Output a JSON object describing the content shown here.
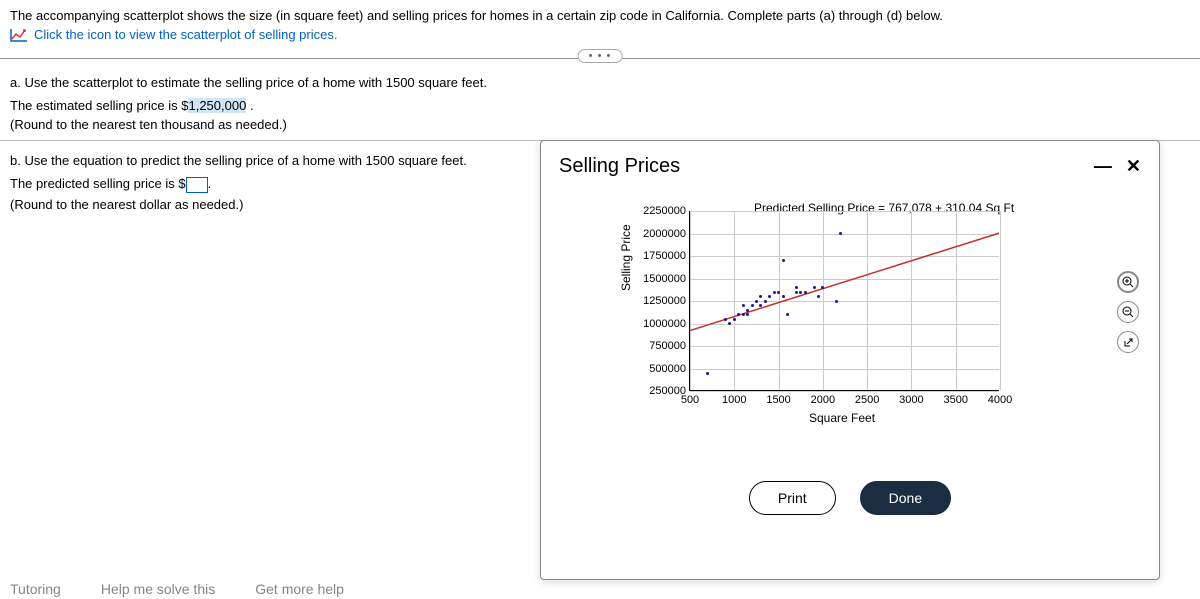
{
  "intro": "The accompanying scatterplot shows the size (in square feet) and selling prices for homes in a certain zip code in California. Complete parts (a) through (d) below.",
  "scatterLink": "Click the icon to view the scatterplot of selling prices.",
  "partA": {
    "q": "a. Use the scatterplot to estimate the selling price of a home with 1500 square feet.",
    "prefix": "The estimated selling price is $",
    "value": "1,250,000",
    "suffix": " .",
    "round": "(Round to the nearest ten thousand as needed.)"
  },
  "partB": {
    "q": "b. Use the equation to predict the selling price of a home with 1500 square feet.",
    "prefix": "The predicted selling price is $",
    "suffix": ".",
    "round": "(Round to the nearest dollar as needed.)"
  },
  "modal": {
    "title": "Selling Prices",
    "equation": "Predicted Selling Price = 767,078 + 310.04 Sq Ft",
    "ylabel": "Selling Price",
    "xlabel": "Square Feet",
    "print": "Print",
    "done": "Done"
  },
  "chart_data": {
    "type": "scatter",
    "title": "Predicted Selling Price = 767,078 + 310.04 Sq Ft",
    "xlabel": "Square Feet",
    "ylabel": "Selling Price",
    "xlim": [
      500,
      4000
    ],
    "ylim": [
      250000,
      2250000
    ],
    "x_ticks": [
      500,
      1000,
      1500,
      2000,
      2500,
      3000,
      3500,
      4000
    ],
    "y_ticks": [
      250000,
      500000,
      750000,
      1000000,
      1250000,
      1500000,
      1750000,
      2000000,
      2250000
    ],
    "regression": {
      "intercept": 767078,
      "slope": 310.04
    },
    "series": [
      {
        "name": "homes",
        "points": [
          [
            700,
            450000
          ],
          [
            900,
            1050000
          ],
          [
            950,
            1000000
          ],
          [
            1000,
            1050000
          ],
          [
            1050,
            1100000
          ],
          [
            1100,
            1100000
          ],
          [
            1100,
            1200000
          ],
          [
            1150,
            1100000
          ],
          [
            1150,
            1150000
          ],
          [
            1200,
            1200000
          ],
          [
            1250,
            1250000
          ],
          [
            1300,
            1200000
          ],
          [
            1300,
            1300000
          ],
          [
            1350,
            1250000
          ],
          [
            1400,
            1300000
          ],
          [
            1450,
            1350000
          ],
          [
            1500,
            1350000
          ],
          [
            1550,
            1300000
          ],
          [
            1550,
            1700000
          ],
          [
            1600,
            1100000
          ],
          [
            1700,
            1350000
          ],
          [
            1700,
            1400000
          ],
          [
            1750,
            1350000
          ],
          [
            1800,
            1350000
          ],
          [
            1900,
            1400000
          ],
          [
            1950,
            1300000
          ],
          [
            2000,
            1400000
          ],
          [
            2150,
            1250000
          ],
          [
            2200,
            2000000
          ]
        ]
      }
    ]
  },
  "bottom": {
    "a": "Tutoring",
    "b": "Help me solve this",
    "c": "Get more help"
  }
}
